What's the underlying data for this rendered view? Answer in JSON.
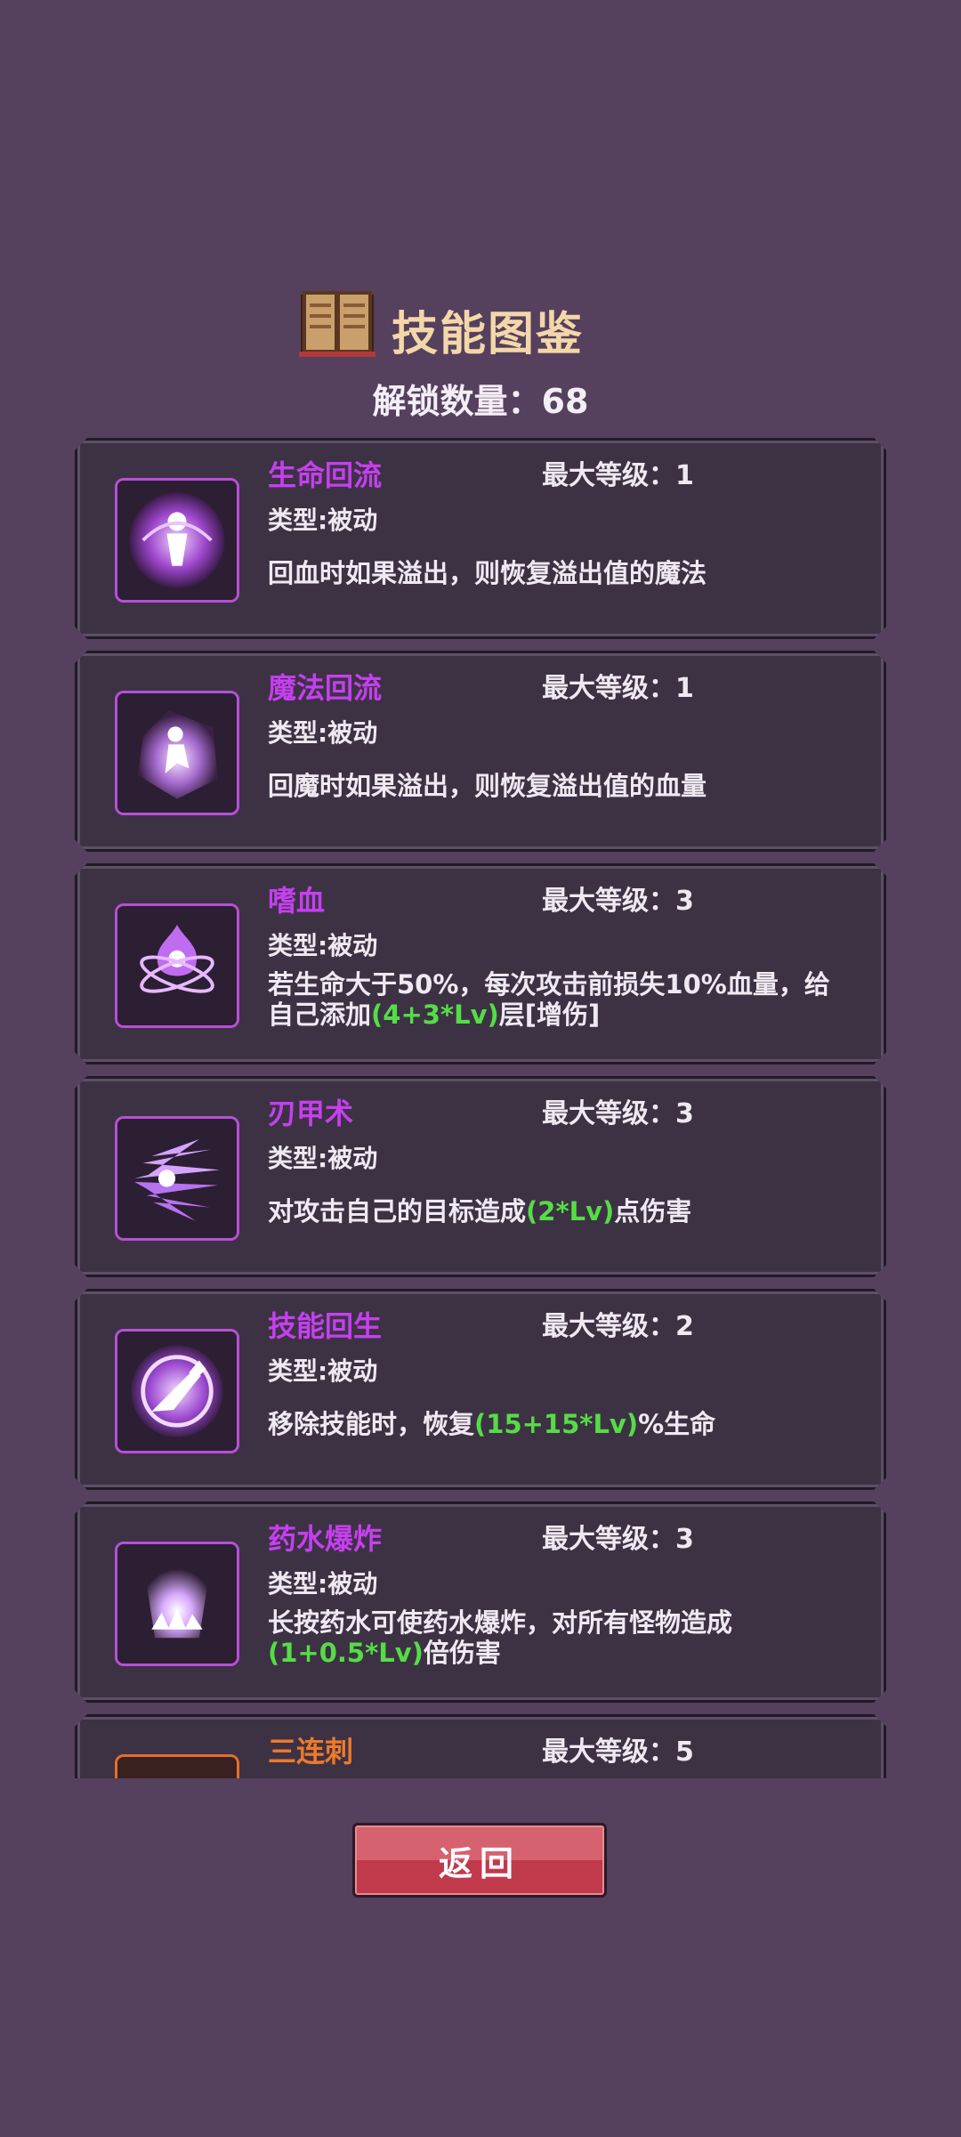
{
  "header": {
    "title": "技能图鉴",
    "unlock_text": "解锁数量：68"
  },
  "skills": [
    {
      "name": "生命回流",
      "max_level": "最大等级：1",
      "type": "类型:被动",
      "desc_pre": "回血时如果溢出，则恢复溢出值的魔法",
      "desc_hl": "",
      "desc_post": "",
      "icon": "life-reflux-icon"
    },
    {
      "name": "魔法回流",
      "max_level": "最大等级：1",
      "type": "类型:被动",
      "desc_pre": "回魔时如果溢出，则恢复溢出值的血量",
      "desc_hl": "",
      "desc_post": "",
      "icon": "magic-reflux-icon"
    },
    {
      "name": "嗜血",
      "max_level": "最大等级：3",
      "type": "类型:被动",
      "desc_pre": "若生命大于50%，每次攻击前损失10%血量，给自己添加",
      "desc_hl": "(4+3*Lv)",
      "desc_post": "层[增伤]",
      "icon": "bloodthirst-icon"
    },
    {
      "name": "刃甲术",
      "max_level": "最大等级：3",
      "type": "类型:被动",
      "desc_pre": "对攻击自己的目标造成",
      "desc_hl": "(2*Lv)",
      "desc_post": "点伤害",
      "icon": "blade-armor-icon"
    },
    {
      "name": "技能回生",
      "max_level": "最大等级：2",
      "type": "类型:被动",
      "desc_pre": "移除技能时，恢复",
      "desc_hl": "(15+15*Lv)",
      "desc_post": "%生命",
      "icon": "skill-regen-icon"
    },
    {
      "name": "药水爆炸",
      "max_level": "最大等级：3",
      "type": "类型:被动",
      "desc_pre": "长按药水可使药水爆炸，对所有怪物造成",
      "desc_hl": "(1+0.5*Lv)",
      "desc_post": "倍伤害",
      "icon": "potion-explosion-icon"
    },
    {
      "name": "三连刺",
      "max_level": "最大等级：5",
      "type": "",
      "desc_pre": "",
      "desc_hl": "",
      "desc_post": "",
      "icon": "triple-stab-icon"
    }
  ],
  "footer": {
    "back_label": "返回"
  },
  "colors": {
    "background": "#55405e",
    "skill_name": "#c63ff0",
    "highlight": "#55dd45",
    "title": "#f4d7a9",
    "back_button": "#c03a4c"
  }
}
